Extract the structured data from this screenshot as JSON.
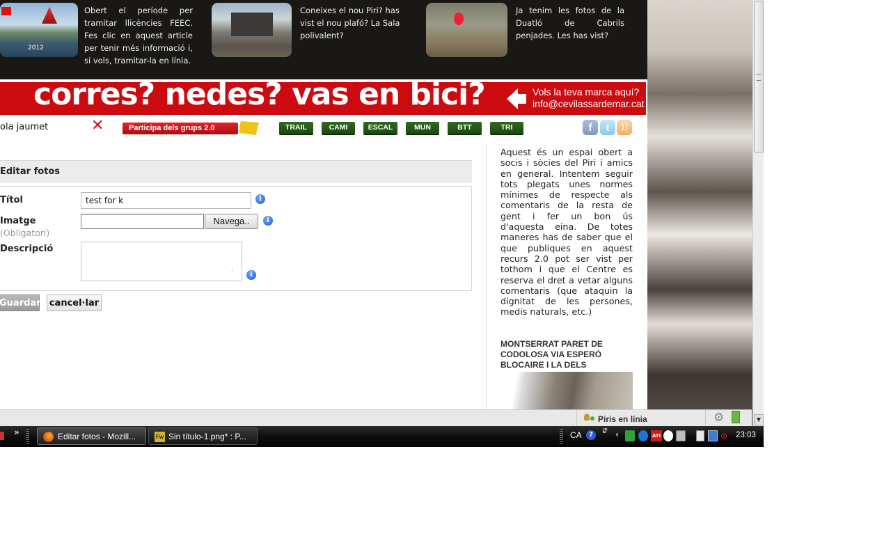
{
  "news": {
    "items": [
      {
        "text": "Obert el període per tramitar llicències FEEC. Fes clic en aquest article per tenir més informació i, si vols, tramitar-la en línia.",
        "thumb_caption": "2012"
      },
      {
        "text": "Coneixes el nou Piri? has vist el nou plafó? La Sala polivalent?"
      },
      {
        "text": "Ja tenim les fotos de la Duatló de Cabrils penjades. Les has vist?"
      }
    ]
  },
  "banner": {
    "slogan": "corres? nedes? vas en bici?",
    "ad_line1": "Vols la teva marca aquí?",
    "ad_line2": "info@cevilassardemar.cat"
  },
  "userbar": {
    "username": "ola jaumet",
    "participate_label": "Participa dels grups 2.0",
    "categories": [
      "TRAIL",
      "CAMI",
      "ESCAL",
      "MUN",
      "BTT",
      "TRI"
    ]
  },
  "form": {
    "section_title": "Editar fotos",
    "title_label": "Títol",
    "title_value": "test for k",
    "image_label": "Imatge",
    "image_required": "(Obligatori)",
    "browse_label": "Navega..",
    "description_label": "Descripció",
    "description_value": "",
    "save_label": "Guardar",
    "cancel_label": "cancel·lar"
  },
  "sidebar": {
    "text": "Aquest és un espai obert a socis i sòcies del Piri i amics en general. Intentem seguir tots plegats unes normes mínimes de respecte als comentaris de la resta de gent i fer un bon ús d'aquesta eina. De totes maneres has de saber que el que publiques en aquest recurs 2.0 pot ser vist per tothom i que el Centre es reserva el dret a vetar alguns comentaris (que ataquin la dignitat de les persones, medis naturals, etc.)",
    "post_title": "MONTSERRAT PARET DE CODOLOSA VIA ESPERÓ BLOCAIRE I LA DELS INDIGNATS"
  },
  "chat": {
    "label": "Piris en línia"
  },
  "taskbar": {
    "chevron": "»",
    "tasks": [
      {
        "label": "Editar fotos - Mozill..."
      },
      {
        "label": "Sin título-1.png* : P..."
      }
    ],
    "lang": "CA",
    "clock": "23:03"
  }
}
